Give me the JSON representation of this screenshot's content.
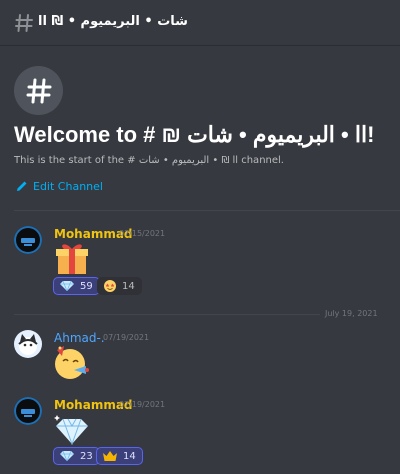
{
  "header": {
    "channel_name": "شات • البريميوم • ₪ اا",
    "hash_symbol": "#"
  },
  "intro": {
    "icon_symbol": "#",
    "welcome_text": "Welcome to # ₪ اا • البريميوم • شات!",
    "start_text": "This is the start of the # اا ₪ • البريميوم • شات channel.",
    "edit_label": "Edit Channel"
  },
  "messages": [
    {
      "username": "Mohammad",
      "timestamp": "07/15/2021",
      "content_emoji": "gift-icon",
      "reactions": [
        {
          "emoji": "diamond-icon",
          "count": "59",
          "active": true
        },
        {
          "emoji": "star-struck-icon",
          "count": "14",
          "active": false
        }
      ]
    },
    {
      "username": "Ahmad-.",
      "timestamp": "07/19/2021",
      "content_emoji": "partying-face-icon",
      "reactions": []
    },
    {
      "username": "Mohammad",
      "timestamp": "07/19/2021",
      "content_emoji": "sparkling-diamond-icon",
      "reactions": [
        {
          "emoji": "diamond-icon",
          "count": "23",
          "active": true
        },
        {
          "emoji": "crown-icon",
          "count": "14",
          "active": true
        }
      ]
    }
  ],
  "date_divider": "July 19, 2021",
  "colors": {
    "background": "#36393f",
    "mohammad_name": "#f1c40f",
    "ahmad_name": "#4ea6ff",
    "link": "#00aff4",
    "reaction_active_border": "#5865f2"
  }
}
